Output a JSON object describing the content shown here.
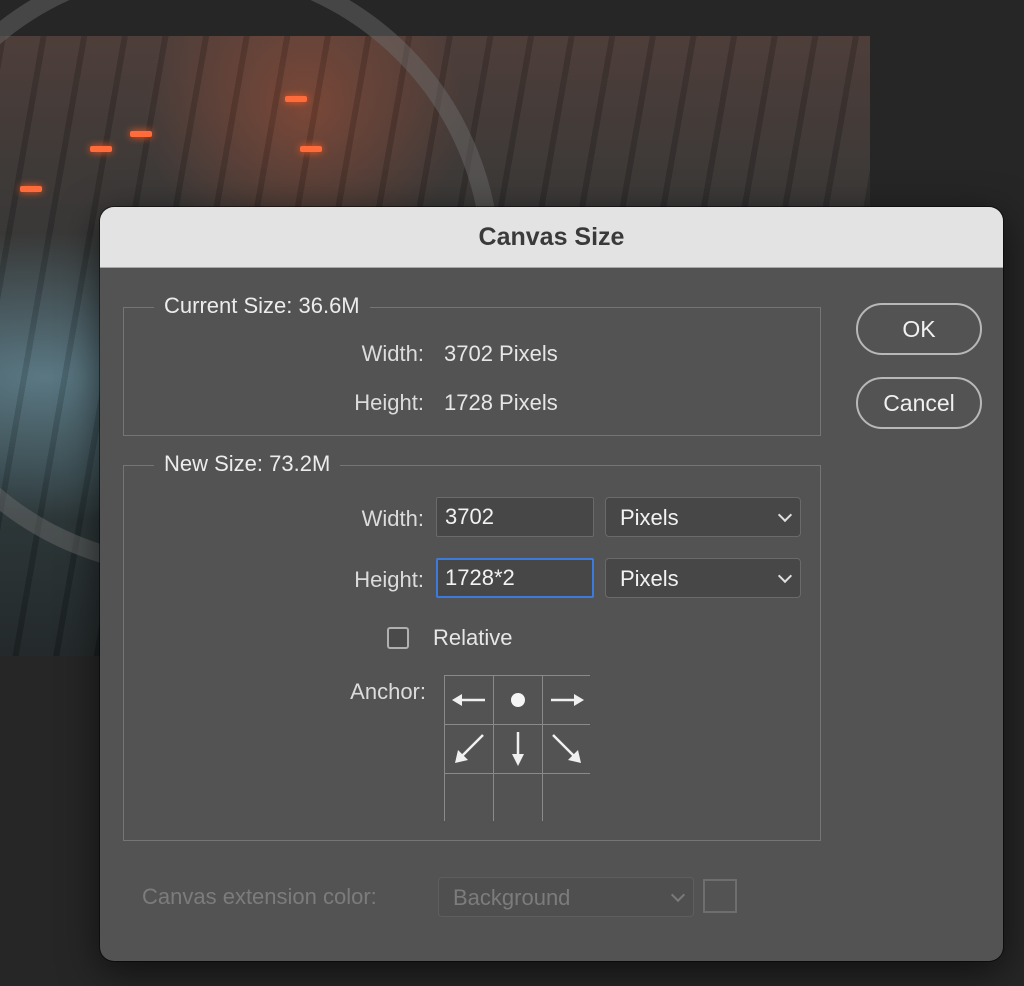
{
  "dialog": {
    "title": "Canvas Size",
    "ok_label": "OK",
    "cancel_label": "Cancel"
  },
  "current_size": {
    "legend": "Current Size: 36.6M",
    "width_label": "Width:",
    "width_value": "3702 Pixels",
    "height_label": "Height:",
    "height_value": "1728 Pixels"
  },
  "new_size": {
    "legend": "New Size: 73.2M",
    "width_label": "Width:",
    "width_value": "3702",
    "width_unit": "Pixels",
    "height_label": "Height:",
    "height_value": "1728*2",
    "height_unit": "Pixels",
    "relative_label": "Relative",
    "relative_checked": false,
    "anchor_label": "Anchor:"
  },
  "extension": {
    "label": "Canvas extension color:",
    "value": "Background"
  },
  "icons": {
    "anchor": [
      "arrow-left-icon",
      "anchor-dot-icon",
      "arrow-right-icon",
      "arrow-down-left-icon",
      "arrow-down-icon",
      "arrow-down-right-icon",
      "empty",
      "empty",
      "empty"
    ]
  },
  "colors": {
    "dialog_bg": "#535353",
    "titlebar_bg": "#e3e3e3",
    "focus_ring": "#3c7bdc"
  }
}
